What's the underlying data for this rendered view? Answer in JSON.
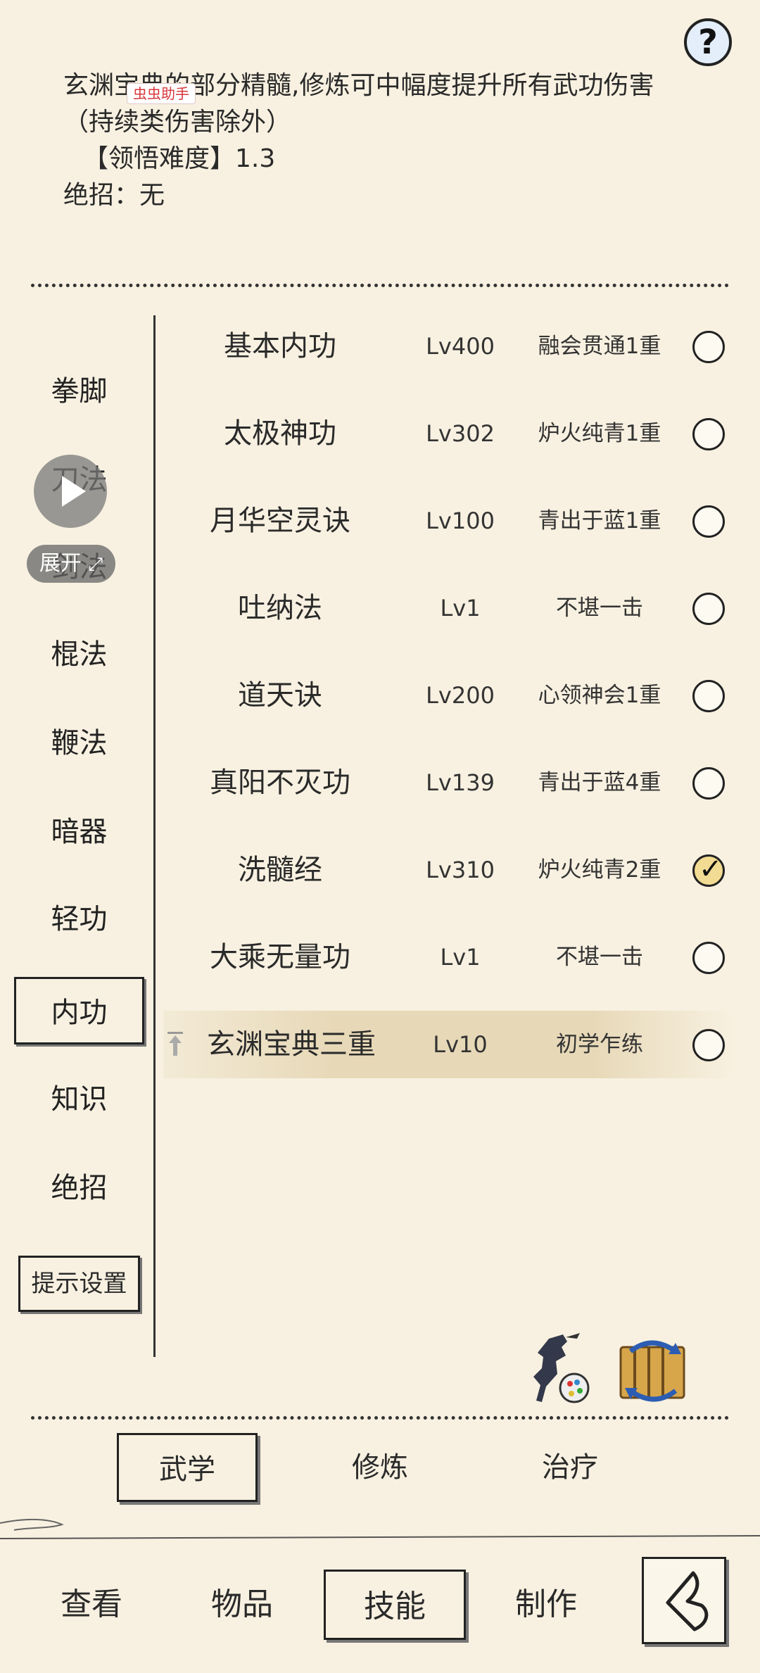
{
  "description": {
    "lines": [
      "玄渊宝典的部分精髓,修炼可中幅度提升所有武功伤害",
      "（持续类伤害除外）",
      "【领悟难度】1.3",
      "绝招：无"
    ],
    "overlay_badge": "虫虫助手"
  },
  "help_button": {
    "icon": "question-icon",
    "label": "?"
  },
  "categories": {
    "items": [
      "拳脚",
      "刀法",
      "剑法",
      "棍法",
      "鞭法",
      "暗器",
      "轻功",
      "内功",
      "知识",
      "绝招"
    ],
    "selected": "内功"
  },
  "tip_settings_label": "提示设置",
  "video_overlay": {
    "expand_label": "展开"
  },
  "skills": [
    {
      "name": "基本内功",
      "level": "Lv400",
      "status": "融会贯通1重",
      "checked": false
    },
    {
      "name": "太极神功",
      "level": "Lv302",
      "status": "炉火纯青1重",
      "checked": false
    },
    {
      "name": "月华空灵诀",
      "level": "Lv100",
      "status": "青出于蓝1重",
      "checked": false
    },
    {
      "name": "吐纳法",
      "level": "Lv1",
      "status": "不堪一击",
      "checked": false
    },
    {
      "name": "道天诀",
      "level": "Lv200",
      "status": "心领神会1重",
      "checked": false
    },
    {
      "name": "真阳不灭功",
      "level": "Lv139",
      "status": "青出于蓝4重",
      "checked": false
    },
    {
      "name": "洗髓经",
      "level": "Lv310",
      "status": "炉火纯青2重",
      "checked": true
    },
    {
      "name": "大乘无量功",
      "level": "Lv1",
      "status": "不堪一击",
      "checked": false
    },
    {
      "name": "玄渊宝典三重",
      "level": "Lv10",
      "status": "初学乍练",
      "checked": false,
      "highlighted": true
    }
  ],
  "sub_tabs": {
    "items": [
      "武学",
      "修炼",
      "治疗"
    ],
    "selected": "武学"
  },
  "bottom_nav": {
    "items": [
      "查看",
      "物品",
      "技能",
      "制作"
    ],
    "selected": "技能"
  },
  "icons": {
    "fighter": "fighter-palette-icon",
    "swap": "book-swap-icon",
    "back": "back-arrow-icon"
  }
}
